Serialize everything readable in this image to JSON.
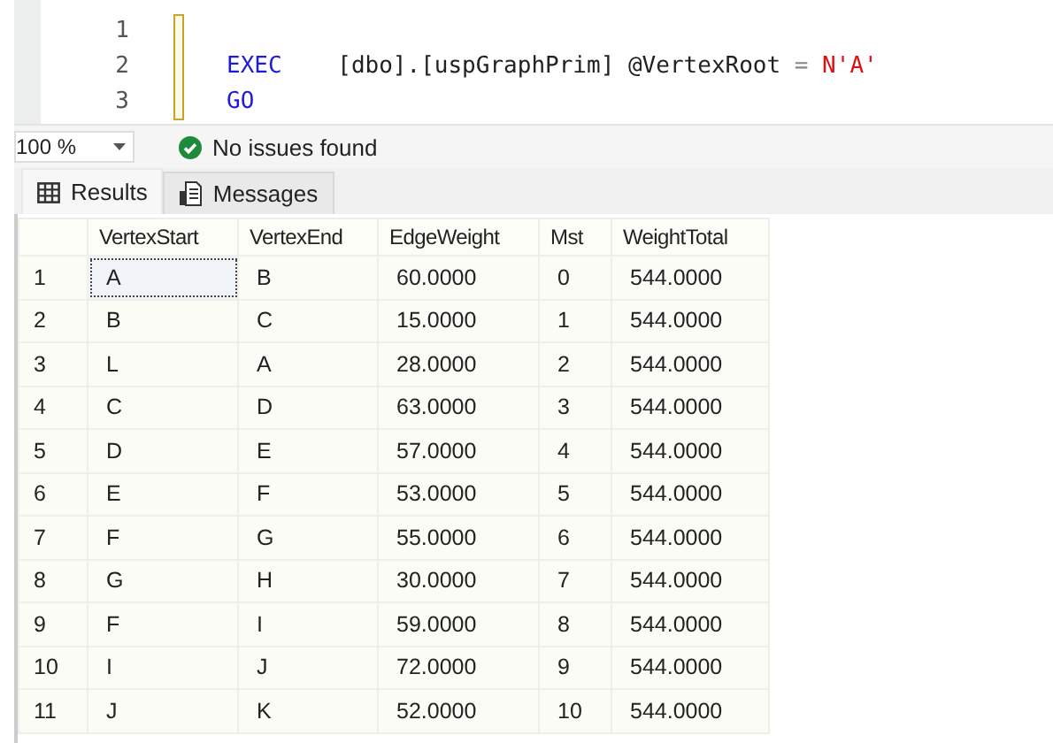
{
  "editor": {
    "lines": [
      {
        "number": "1"
      },
      {
        "number": "2",
        "tokens": [
          {
            "kind": "keyword",
            "text": "EXEC"
          },
          {
            "kind": "plain",
            "text": "    [dbo].[uspGraphPrim] @VertexRoot "
          },
          {
            "kind": "operator",
            "text": "="
          },
          {
            "kind": "string",
            "text": "N'A'"
          }
        ]
      },
      {
        "number": "3",
        "tokens": [
          {
            "kind": "keyword",
            "text": "GO"
          }
        ]
      }
    ]
  },
  "status": {
    "zoom": "100 %",
    "message": "No issues found"
  },
  "tabs": [
    {
      "label": "Results",
      "selected": true,
      "kind": "grid"
    },
    {
      "label": "Messages",
      "selected": false,
      "kind": "messages"
    }
  ],
  "table": {
    "columns": [
      "VertexStart",
      "VertexEnd",
      "EdgeWeight",
      "Mst",
      "WeightTotal"
    ],
    "rows": [
      {
        "number": "1",
        "cells": [
          {
            "text": "A",
            "selected": true
          },
          {
            "text": "B",
            "selected": false
          },
          {
            "text": "60.0000",
            "selected": false
          },
          {
            "text": "0",
            "selected": false
          },
          {
            "text": "544.0000",
            "selected": false
          }
        ]
      },
      {
        "number": "2",
        "cells": [
          {
            "text": "B",
            "selected": false
          },
          {
            "text": "C",
            "selected": false
          },
          {
            "text": "15.0000",
            "selected": false
          },
          {
            "text": "1",
            "selected": false
          },
          {
            "text": "544.0000",
            "selected": false
          }
        ]
      },
      {
        "number": "3",
        "cells": [
          {
            "text": "L",
            "selected": false
          },
          {
            "text": "A",
            "selected": false
          },
          {
            "text": "28.0000",
            "selected": false
          },
          {
            "text": "2",
            "selected": false
          },
          {
            "text": "544.0000",
            "selected": false
          }
        ]
      },
      {
        "number": "4",
        "cells": [
          {
            "text": "C",
            "selected": false
          },
          {
            "text": "D",
            "selected": false
          },
          {
            "text": "63.0000",
            "selected": false
          },
          {
            "text": "3",
            "selected": false
          },
          {
            "text": "544.0000",
            "selected": false
          }
        ]
      },
      {
        "number": "5",
        "cells": [
          {
            "text": "D",
            "selected": false
          },
          {
            "text": "E",
            "selected": false
          },
          {
            "text": "57.0000",
            "selected": false
          },
          {
            "text": "4",
            "selected": false
          },
          {
            "text": "544.0000",
            "selected": false
          }
        ]
      },
      {
        "number": "6",
        "cells": [
          {
            "text": "E",
            "selected": false
          },
          {
            "text": "F",
            "selected": false
          },
          {
            "text": "53.0000",
            "selected": false
          },
          {
            "text": "5",
            "selected": false
          },
          {
            "text": "544.0000",
            "selected": false
          }
        ]
      },
      {
        "number": "7",
        "cells": [
          {
            "text": "F",
            "selected": false
          },
          {
            "text": "G",
            "selected": false
          },
          {
            "text": "55.0000",
            "selected": false
          },
          {
            "text": "6",
            "selected": false
          },
          {
            "text": "544.0000",
            "selected": false
          }
        ]
      },
      {
        "number": "8",
        "cells": [
          {
            "text": "G",
            "selected": false
          },
          {
            "text": "H",
            "selected": false
          },
          {
            "text": "30.0000",
            "selected": false
          },
          {
            "text": "7",
            "selected": false
          },
          {
            "text": "544.0000",
            "selected": false
          }
        ]
      },
      {
        "number": "9",
        "cells": [
          {
            "text": "F",
            "selected": false
          },
          {
            "text": "I",
            "selected": false
          },
          {
            "text": "59.0000",
            "selected": false
          },
          {
            "text": "8",
            "selected": false
          },
          {
            "text": "544.0000",
            "selected": false
          }
        ]
      },
      {
        "number": "10",
        "cells": [
          {
            "text": "I",
            "selected": false
          },
          {
            "text": "J",
            "selected": false
          },
          {
            "text": "72.0000",
            "selected": false
          },
          {
            "text": "9",
            "selected": false
          },
          {
            "text": "544.0000",
            "selected": false
          }
        ]
      },
      {
        "number": "11",
        "cells": [
          {
            "text": "J",
            "selected": false
          },
          {
            "text": "K",
            "selected": false
          },
          {
            "text": "52.0000",
            "selected": false
          },
          {
            "text": "10",
            "selected": false
          },
          {
            "text": "544.0000",
            "selected": false
          }
        ]
      }
    ]
  }
}
